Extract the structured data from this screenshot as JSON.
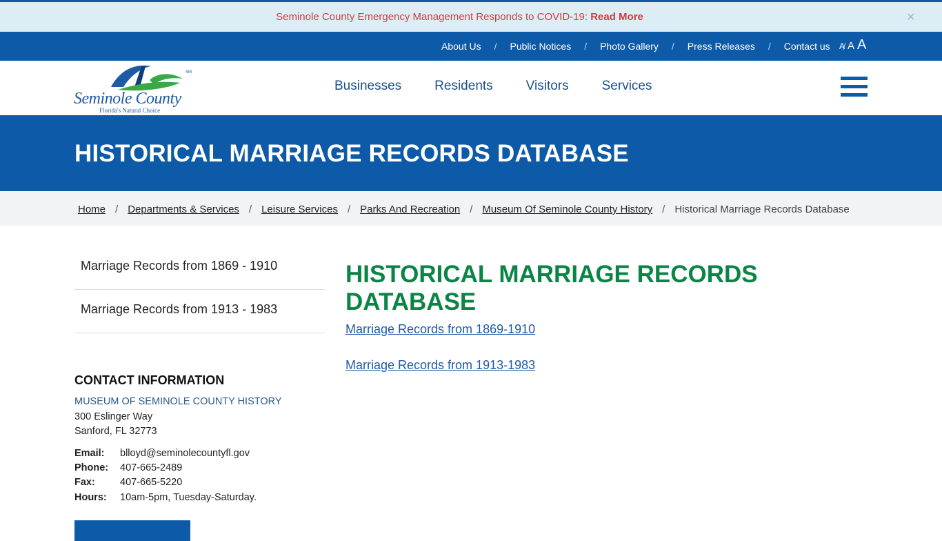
{
  "alert": {
    "message": "Seminole County Emergency Management  Responds to COVID-19:",
    "link": "Read More",
    "close": "×"
  },
  "utility_nav": [
    {
      "label": "About Us"
    },
    {
      "label": "Public Notices"
    },
    {
      "label": "Photo Gallery"
    },
    {
      "label": "Press Releases"
    },
    {
      "label": "Contact us"
    }
  ],
  "font_size_controls": [
    "A",
    "A",
    "A"
  ],
  "logo": {
    "name": "Seminole County",
    "tagline": "Florida's Natural Choice"
  },
  "main_nav": [
    {
      "label": "Businesses"
    },
    {
      "label": "Residents"
    },
    {
      "label": "Visitors"
    },
    {
      "label": "Services"
    }
  ],
  "hero": {
    "title": "HISTORICAL MARRIAGE RECORDS DATABASE"
  },
  "breadcrumb": {
    "items": [
      "Home",
      "Departments & Services",
      "Leisure Services",
      "Parks And Recreation",
      "Museum Of Seminole County History"
    ],
    "current": "Historical Marriage Records Database",
    "separator": "/"
  },
  "sidebar": {
    "items": [
      {
        "label": "Marriage Records from 1869 - 1910"
      },
      {
        "label": "Marriage Records from 1913 - 1983"
      }
    ]
  },
  "contact": {
    "heading": "CONTACT INFORMATION",
    "org": "MUSEUM OF SEMINOLE COUNTY HISTORY",
    "address1": "300 Eslinger Way",
    "address2": "Sanford, FL 32773",
    "email_label": "Email:",
    "email": "blloyd@seminolecountyfl.gov",
    "phone_label": "Phone:",
    "phone": "407-665-2489",
    "fax_label": "Fax:",
    "fax": "407-665-5220",
    "hours_label": "Hours:",
    "hours": "10am-5pm, Tuesday-Saturday."
  },
  "content": {
    "title": "HISTORICAL MARRIAGE RECORDS DATABASE",
    "links": [
      {
        "label": "Marriage Records from 1869-1910"
      },
      {
        "label": "Marriage Records from 1913-1983"
      }
    ]
  },
  "colors": {
    "brand_blue": "#0d5ba8",
    "heading_green": "#0a8546",
    "alert_red": "#d13c3c"
  }
}
